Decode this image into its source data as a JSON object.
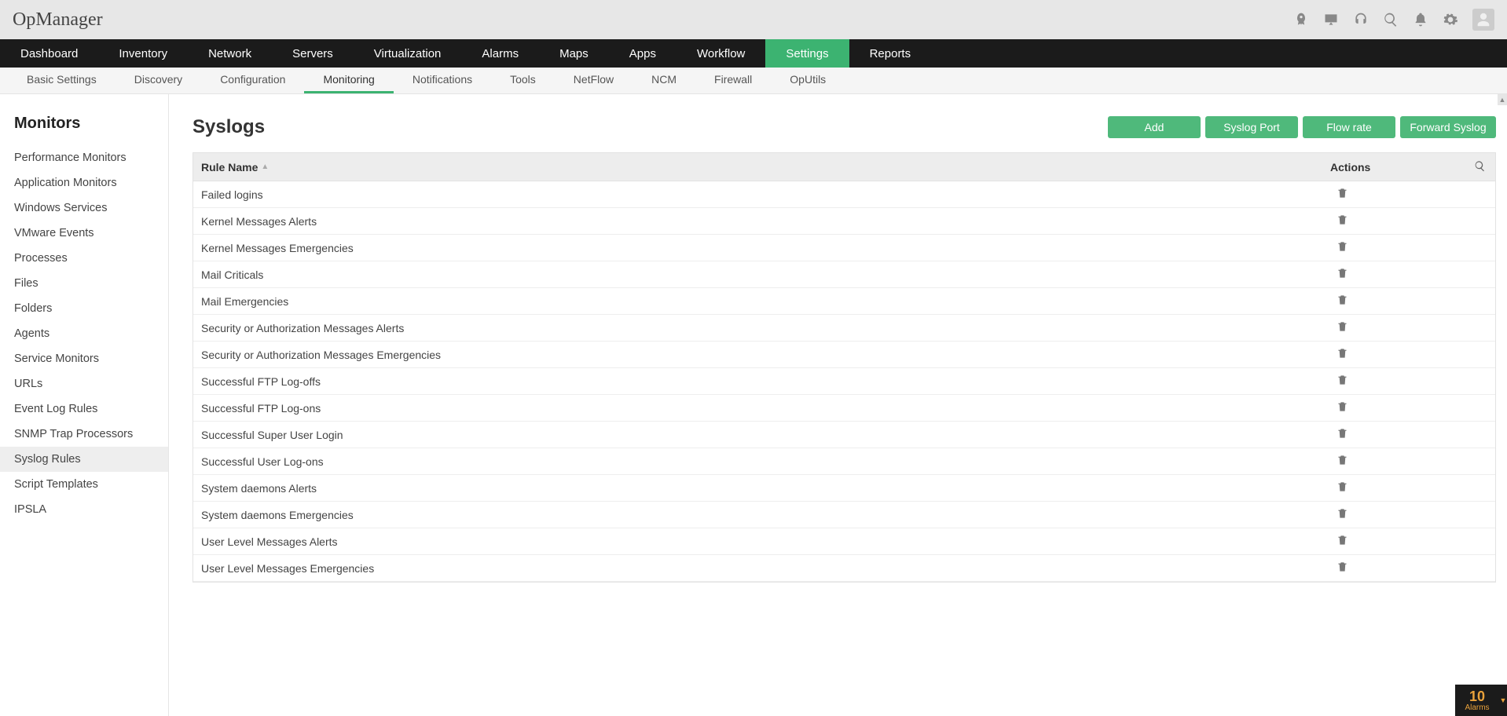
{
  "brand": "OpManager",
  "mainnav": [
    {
      "label": "Dashboard",
      "active": false
    },
    {
      "label": "Inventory",
      "active": false
    },
    {
      "label": "Network",
      "active": false
    },
    {
      "label": "Servers",
      "active": false
    },
    {
      "label": "Virtualization",
      "active": false
    },
    {
      "label": "Alarms",
      "active": false
    },
    {
      "label": "Maps",
      "active": false
    },
    {
      "label": "Apps",
      "active": false
    },
    {
      "label": "Workflow",
      "active": false
    },
    {
      "label": "Settings",
      "active": true
    },
    {
      "label": "Reports",
      "active": false
    }
  ],
  "subnav": [
    {
      "label": "Basic Settings",
      "active": false
    },
    {
      "label": "Discovery",
      "active": false
    },
    {
      "label": "Configuration",
      "active": false
    },
    {
      "label": "Monitoring",
      "active": true
    },
    {
      "label": "Notifications",
      "active": false
    },
    {
      "label": "Tools",
      "active": false
    },
    {
      "label": "NetFlow",
      "active": false
    },
    {
      "label": "NCM",
      "active": false
    },
    {
      "label": "Firewall",
      "active": false
    },
    {
      "label": "OpUtils",
      "active": false
    }
  ],
  "sidebar": {
    "heading": "Monitors",
    "items": [
      {
        "label": "Performance Monitors",
        "active": false
      },
      {
        "label": "Application Monitors",
        "active": true
      },
      {
        "label": "Windows Services",
        "active": false
      },
      {
        "label": "VMware Events",
        "active": false
      },
      {
        "label": "Processes",
        "active": false
      },
      {
        "label": "Files",
        "active": false
      },
      {
        "label": "Folders",
        "active": false
      },
      {
        "label": "Agents",
        "active": false
      },
      {
        "label": "Service Monitors",
        "active": false
      },
      {
        "label": "URLs",
        "active": false
      },
      {
        "label": "Event Log Rules",
        "active": false
      },
      {
        "label": "SNMP Trap Processors",
        "active": false
      },
      {
        "label": "Syslog Rules",
        "active": true
      },
      {
        "label": "Script Templates",
        "active": false
      },
      {
        "label": "IPSLA",
        "active": false
      }
    ]
  },
  "page": {
    "title": "Syslogs",
    "buttons": {
      "add": "Add",
      "port": "Syslog Port",
      "flow": "Flow rate",
      "forward": "Forward Syslog"
    }
  },
  "table": {
    "col_rule": "Rule Name",
    "col_actions": "Actions",
    "rows": [
      {
        "name": "Failed logins"
      },
      {
        "name": "Kernel Messages Alerts"
      },
      {
        "name": "Kernel Messages Emergencies"
      },
      {
        "name": "Mail Criticals"
      },
      {
        "name": "Mail Emergencies"
      },
      {
        "name": "Security or Authorization Messages Alerts"
      },
      {
        "name": "Security or Authorization Messages Emergencies"
      },
      {
        "name": "Successful FTP Log-offs"
      },
      {
        "name": "Successful FTP Log-ons"
      },
      {
        "name": "Successful Super User Login"
      },
      {
        "name": "Successful User Log-ons"
      },
      {
        "name": "System daemons Alerts"
      },
      {
        "name": "System daemons Emergencies"
      },
      {
        "name": "User Level Messages Alerts"
      },
      {
        "name": "User Level Messages Emergencies"
      }
    ]
  },
  "alarm": {
    "count": "10",
    "label": "Alarms"
  }
}
